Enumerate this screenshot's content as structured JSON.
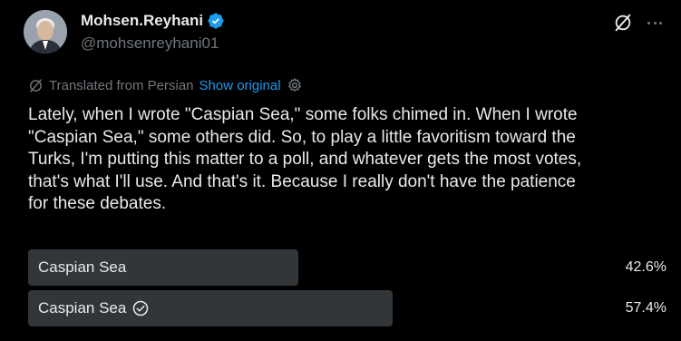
{
  "author": {
    "display_name": "Mohsen.Reyhani",
    "handle": "@mohsenreyhani01",
    "verified_icon": "verified-badge-icon"
  },
  "header_actions": {
    "grok_icon": "grok-icon",
    "more_icon": "more-icon"
  },
  "translation": {
    "label": "Translated from Persian",
    "show_original": "Show original",
    "icon": "translate-icon",
    "settings_icon": "gear-icon"
  },
  "tweet": {
    "text": "Lately, when I wrote \"Caspian Sea,\" some folks chimed in. When I wrote\n\"Caspian Sea,\" some others did. So, to play a little favoritism toward the\nTurks, I'm putting this matter to a poll, and whatever gets the most votes,\nthat's what I'll use. And that's it. Because I really don't have the patience\nfor these debates."
  },
  "poll": {
    "options": [
      {
        "label": "Caspian Sea",
        "percent_text": "42.6%",
        "percent": 42.6,
        "winner": false
      },
      {
        "label": "Caspian Sea",
        "percent_text": "57.4%",
        "percent": 57.4,
        "winner": true
      }
    ]
  },
  "colors": {
    "background": "#000000",
    "text": "#e7e9ea",
    "secondary_text": "#71767b",
    "link": "#1d9bf0",
    "poll_bar": "#333639",
    "verified": "#1d9bf0"
  }
}
